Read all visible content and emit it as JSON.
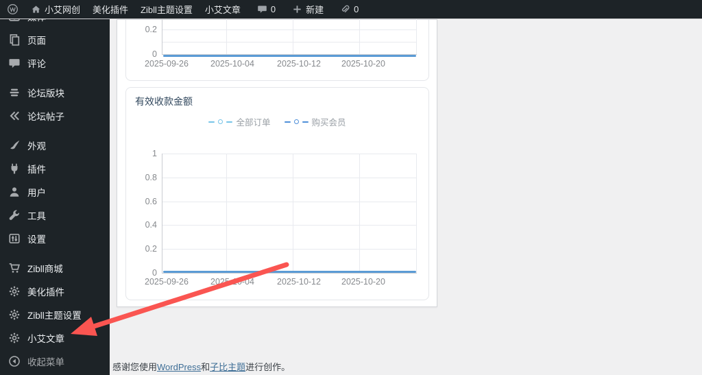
{
  "admin_bar": {
    "site_name": "小艾网创",
    "menu_beautify": "美化插件",
    "menu_zibll": "Zibll主题设置",
    "menu_xiaoai": "小艾文章",
    "comments_count": "0",
    "new_label": "新建",
    "links_count": "0"
  },
  "sidebar": {
    "items": [
      {
        "label": "媒体",
        "icon": "media-icon"
      },
      {
        "label": "页面",
        "icon": "pages-icon"
      },
      {
        "label": "评论",
        "icon": "comments-icon"
      },
      {
        "label": "论坛版块",
        "icon": "forum-board-icon"
      },
      {
        "label": "论坛帖子",
        "icon": "forum-posts-icon"
      },
      {
        "label": "外观",
        "icon": "appearance-icon"
      },
      {
        "label": "插件",
        "icon": "plugin-icon"
      },
      {
        "label": "用户",
        "icon": "users-icon"
      },
      {
        "label": "工具",
        "icon": "tools-icon"
      },
      {
        "label": "设置",
        "icon": "settings-icon"
      },
      {
        "label": "Zibll商城",
        "icon": "cart-icon"
      },
      {
        "label": "美化插件",
        "icon": "gear-icon"
      },
      {
        "label": "Zibll主题设置",
        "icon": "gear-icon"
      },
      {
        "label": "小艾文章",
        "icon": "gear-icon"
      }
    ],
    "collapse_label": "收起菜单"
  },
  "panel": {
    "title": "有效收款金额"
  },
  "chart_data": [
    {
      "type": "line",
      "note": "top chart, upper part cropped by viewport",
      "x": [
        "2025-09-26",
        "2025-10-04",
        "2025-10-12",
        "2025-10-20"
      ],
      "series": [
        {
          "name": "",
          "values": [
            0,
            0,
            0,
            0
          ]
        }
      ],
      "yticks_visible": [
        0.2,
        0
      ],
      "line_color": "#5b9bd5",
      "grid": true
    },
    {
      "type": "line",
      "title": "有效收款金额",
      "x": [
        "2025-09-26",
        "2025-10-04",
        "2025-10-12",
        "2025-10-20"
      ],
      "series": [
        {
          "name": "全部订单",
          "values": [
            0,
            0,
            0,
            0
          ],
          "color": "#76c4e8"
        },
        {
          "name": "购买会员",
          "values": [
            0,
            0,
            0,
            0
          ],
          "color": "#4e8fd9"
        }
      ],
      "ylim": [
        0,
        1
      ],
      "yticks": [
        1,
        0.8,
        0.6,
        0.4,
        0.2,
        0
      ],
      "legend_position": "top-center",
      "grid": true,
      "line_color": "#5b9bd5"
    }
  ],
  "annotation": {
    "type": "arrow",
    "color": "#fa5551",
    "points_to": "小艾文章 sidebar item"
  },
  "footer": {
    "pre": "感谢您使用",
    "link_wordpress": "WordPress",
    "mid": "和",
    "link_theme": "子比主题",
    "post": "进行创作。"
  },
  "colors": {
    "admin_dark": "#1d2327",
    "content_bg": "#f0f0f1",
    "chart_line": "#5b9bd5",
    "arrow_red": "#fa5551",
    "link_blue": "#3e6e96"
  }
}
